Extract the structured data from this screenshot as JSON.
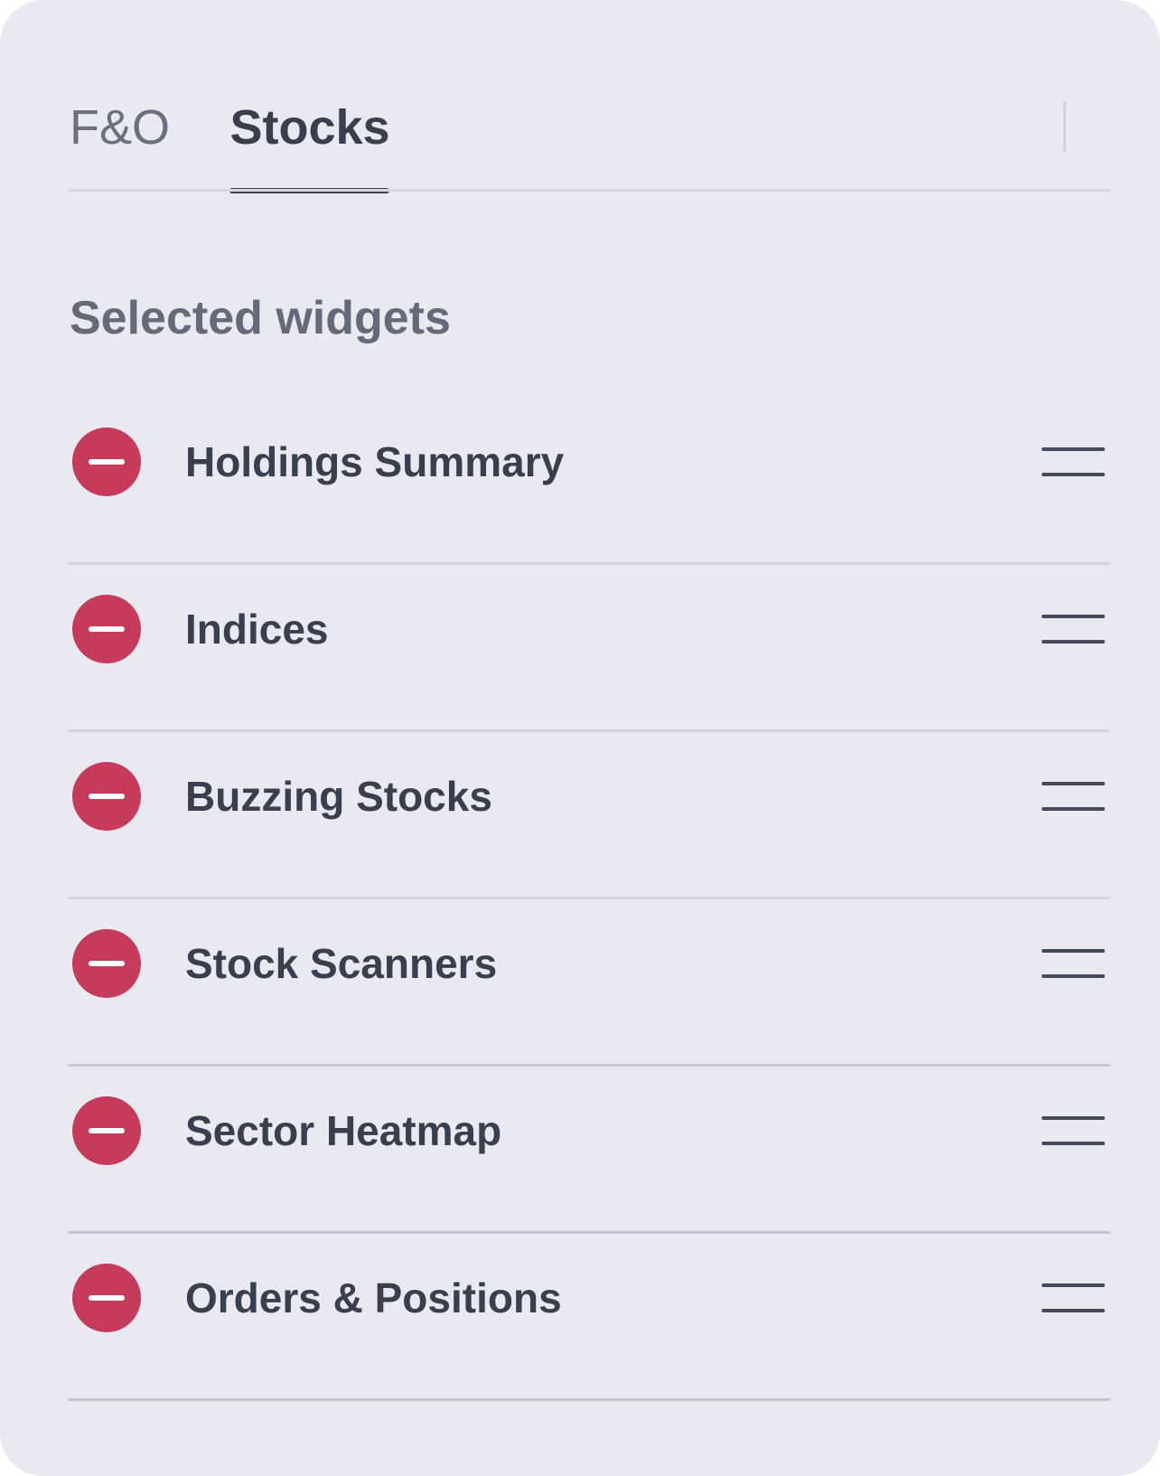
{
  "tabs": [
    {
      "label": "F&O",
      "active": false
    },
    {
      "label": "Stocks",
      "active": true
    }
  ],
  "section": {
    "title": "Selected widgets"
  },
  "widgets": [
    {
      "label": "Holdings Summary"
    },
    {
      "label": "Indices"
    },
    {
      "label": "Buzzing Stocks"
    },
    {
      "label": "Stock Scanners"
    },
    {
      "label": "Sector Heatmap"
    },
    {
      "label": "Orders & Positions"
    }
  ],
  "icons": {
    "remove": "minus-circle-icon",
    "drag": "drag-handle-icon"
  },
  "colors": {
    "panel_background": "#e8e9f1",
    "remove_red": "#c63a5a",
    "text_primary": "#3a3f4f",
    "text_secondary": "#646a7a"
  }
}
